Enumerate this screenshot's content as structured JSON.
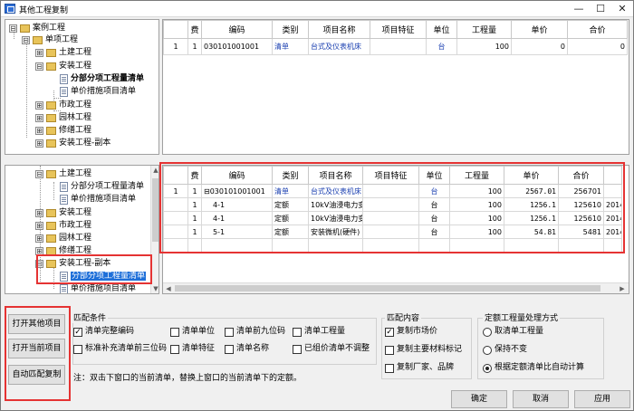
{
  "window": {
    "title": "其他工程复制",
    "min": "—",
    "max": "☐",
    "close": "✕"
  },
  "top_tree": {
    "items": [
      {
        "label": "案例工程",
        "expander": "⊟"
      },
      {
        "label": "单项工程",
        "expander": "⊟"
      },
      {
        "label": "土建工程",
        "expander": "⊞"
      },
      {
        "label": "安装工程",
        "expander": "⊟"
      },
      {
        "label": "分部分项工程量清单"
      },
      {
        "label": "单价措施项目清单"
      },
      {
        "label": "市政工程",
        "expander": "⊞"
      },
      {
        "label": "园林工程",
        "expander": "⊞"
      },
      {
        "label": "修缮工程",
        "expander": "⊞"
      },
      {
        "label": "安装工程-副本",
        "expander": "⊞"
      }
    ]
  },
  "bottom_tree": {
    "items": [
      {
        "label": "土建工程",
        "expander": "⊟"
      },
      {
        "label": "分部分项工程量清单"
      },
      {
        "label": "单价措施项目清单"
      },
      {
        "label": "安装工程",
        "expander": "⊞"
      },
      {
        "label": "市政工程",
        "expander": "⊞"
      },
      {
        "label": "园林工程",
        "expander": "⊞"
      },
      {
        "label": "修缮工程",
        "expander": "⊞"
      },
      {
        "label": "安装工程-副本",
        "expander": "⊟"
      },
      {
        "label": "分部分项工程量清单"
      },
      {
        "label": "单价措施项目清单"
      }
    ]
  },
  "columns": [
    "费",
    "编码",
    "类别",
    "项目名称",
    "项目特征",
    "单位",
    "工程量",
    "单价",
    "合价"
  ],
  "top_table": {
    "rows": [
      {
        "idx": "1",
        "fee": "1",
        "code": "030101001001",
        "type": "清单",
        "name": "台式及仪表机床",
        "feature": "",
        "unit": "台",
        "qty": "100",
        "price": "0",
        "total": "0"
      }
    ]
  },
  "bottom_table": {
    "rows": [
      {
        "idx": "1",
        "fee": "1",
        "code": "⊟030101001001",
        "type": "清单",
        "name": "台式及仪表机床",
        "feature": "",
        "unit": "台",
        "qty": "100",
        "price": "2567.01",
        "total": "256701",
        "extra": ""
      },
      {
        "idx": "",
        "fee": "1",
        "code": "4-1",
        "type": "定额",
        "name": "10kV油浸电力变",
        "feature": "",
        "unit": "台",
        "qty": "100",
        "price": "1256.1",
        "total": "125610",
        "extra": "2014"
      },
      {
        "idx": "",
        "fee": "1",
        "code": "4-1",
        "type": "定额",
        "name": "10kV油浸电力变",
        "feature": "",
        "unit": "台",
        "qty": "100",
        "price": "1256.1",
        "total": "125610",
        "extra": "2014"
      },
      {
        "idx": "",
        "fee": "1",
        "code": "5-1",
        "type": "定额",
        "name": "安装微机(硬件)",
        "feature": "",
        "unit": "台",
        "qty": "100",
        "price": "54.81",
        "total": "5481",
        "extra": "2014"
      }
    ]
  },
  "buttons": {
    "open_other": "打开其他项目",
    "open_current": "打开当前项目",
    "auto_match": "自动匹配复制",
    "ok": "确定",
    "cancel": "取消",
    "apply": "应用"
  },
  "match_conditions": {
    "title": "匹配条件",
    "options": [
      {
        "label": "清单完整编码",
        "checked": true
      },
      {
        "label": "清单单位",
        "checked": false
      },
      {
        "label": "清单前九位码",
        "checked": false
      },
      {
        "label": "清单工程量",
        "checked": false
      },
      {
        "label": "标准补充清单前三位码",
        "checked": false
      },
      {
        "label": "清单特征",
        "checked": false
      },
      {
        "label": "清单名称",
        "checked": false
      },
      {
        "label": "已组价清单不调整",
        "checked": false
      }
    ]
  },
  "match_content": {
    "title": "匹配内容",
    "options": [
      {
        "label": "复制市场价",
        "checked": true
      },
      {
        "label": "复制主要材料标记",
        "checked": false
      },
      {
        "label": "复制厂家、品牌",
        "checked": false
      }
    ]
  },
  "quota_processing": {
    "title": "定额工程量处理方式",
    "options": [
      {
        "label": "取清单工程量",
        "selected": false
      },
      {
        "label": "保持不变",
        "selected": false
      },
      {
        "label": "根据定额清单比自动计算",
        "selected": true
      }
    ]
  },
  "note": "注：双击下窗口的当前清单，替换上窗口的当前清单下的定额。",
  "check_mark": "✓"
}
